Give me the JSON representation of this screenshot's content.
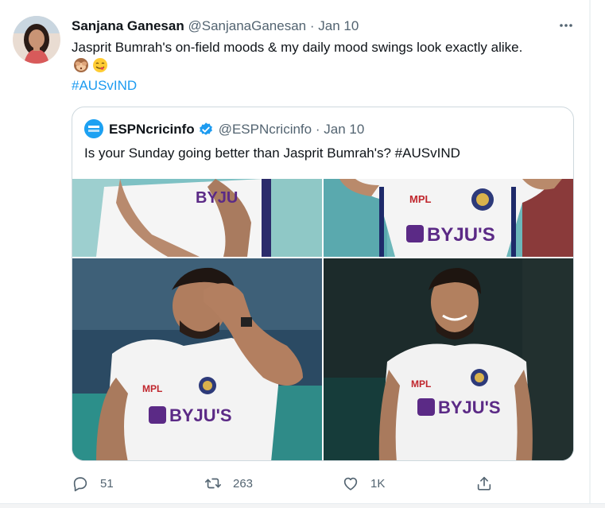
{
  "tweet": {
    "author_name": "Sanjana Ganesan",
    "author_handle": "@SanjanaGanesan",
    "separator": "·",
    "date": "Jan 10",
    "text": "Jasprit Bumrah's on-field moods & my daily mood swings look exactly alike.",
    "emojis": [
      "see-no-evil-monkey",
      "face-savoring-food"
    ],
    "hashtag": "#AUSvIND"
  },
  "quoted_tweet": {
    "author_name": "ESPNcricinfo",
    "verified": true,
    "author_handle": "@ESPNcricinfo",
    "separator": "·",
    "date": "Jan 10",
    "text": "Is your Sunday going better than Jasprit Bumrah's? #AUSvIND",
    "photos": [
      {
        "name": "photo-top-left",
        "jersey_text": "BYJU"
      },
      {
        "name": "photo-top-right",
        "jersey_text": "BYJU'S",
        "logo_text": "MPL"
      },
      {
        "name": "photo-bottom-left",
        "jersey_text": "BYJU'S",
        "logo_text": "MPL"
      },
      {
        "name": "photo-bottom-right",
        "jersey_text": "BYJU'S",
        "logo_text": "MPL"
      }
    ]
  },
  "actions": {
    "replies": "51",
    "retweets": "263",
    "likes": "1K"
  },
  "colors": {
    "link": "#1d9bf0",
    "secondary_text": "#536471",
    "border": "#cfd9de",
    "verified": "#1d9bf0",
    "jersey_purple": "#5b2a86"
  }
}
